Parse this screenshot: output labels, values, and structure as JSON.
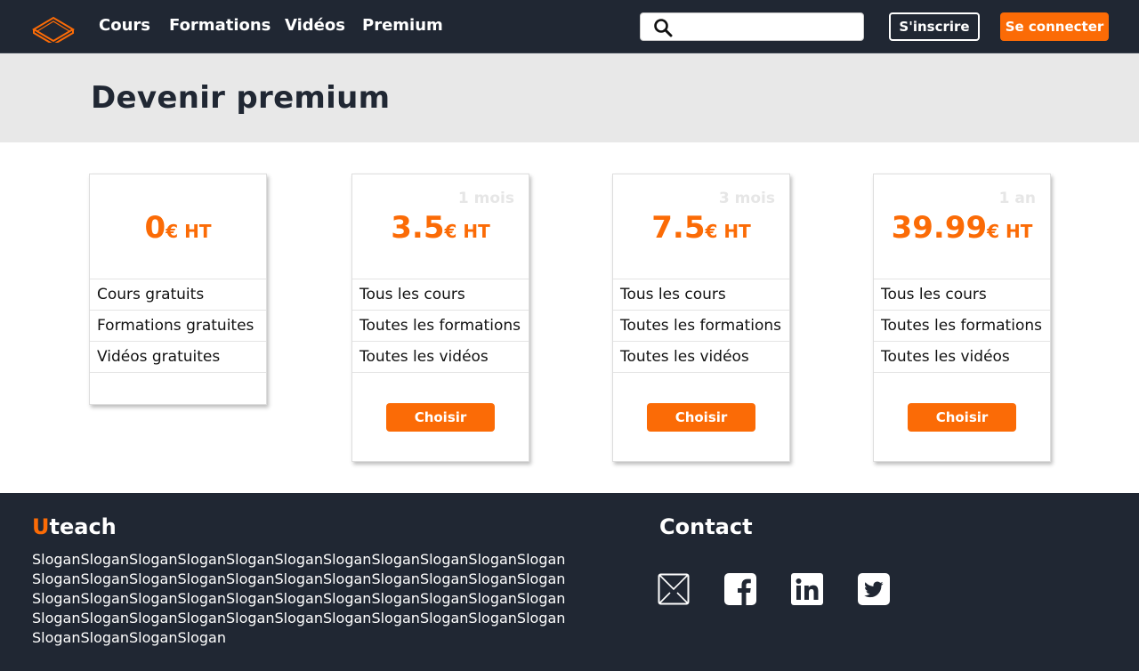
{
  "nav": {
    "links": [
      "Cours",
      "Formations",
      "Vidéos",
      "Premium"
    ],
    "search": {
      "value": "",
      "placeholder": ""
    },
    "signup_label": "S'inscrire",
    "login_label": "Se connecter"
  },
  "hero": {
    "title": "Devenir premium"
  },
  "plans": [
    {
      "period": "",
      "price": "0",
      "unit": "€ HT",
      "features": [
        "Cours gratuits",
        "Formations gratuites",
        "Vidéos gratuites"
      ],
      "button": ""
    },
    {
      "period": "1 mois",
      "price": "3.5",
      "unit": "€ HT",
      "features": [
        "Tous les cours",
        "Toutes les formations",
        "Toutes les vidéos"
      ],
      "button": "Choisir"
    },
    {
      "period": "3 mois",
      "price": "7.5",
      "unit": "€ HT",
      "features": [
        "Tous les cours",
        "Toutes les formations",
        "Toutes les vidéos"
      ],
      "button": "Choisir"
    },
    {
      "period": "1 an",
      "price": "39.99",
      "unit": "€ HT",
      "features": [
        "Tous les cours",
        "Toutes les formations",
        "Toutes les vidéos"
      ],
      "button": "Choisir"
    }
  ],
  "footer": {
    "brand_first": "U",
    "brand_rest": "teach",
    "slogan": "SloganSloganSloganSloganSloganSloganSloganSloganSloganSloganSloganSloganSloganSloganSloganSloganSloganSloganSloganSloganSloganSloganSloganSloganSloganSloganSloganSloganSloganSloganSloganSloganSloganSloganSloganSloganSloganSloganSloganSloganSloganSloganSloganSloganSloganSloganSloganSlogan",
    "contact_title": "Contact",
    "social_icons": [
      "email-icon",
      "facebook-icon",
      "linkedin-icon",
      "twitter-icon"
    ]
  },
  "colors": {
    "accent": "#fb6b06",
    "dark": "#202733",
    "hero_bg": "#e8e8e8"
  }
}
